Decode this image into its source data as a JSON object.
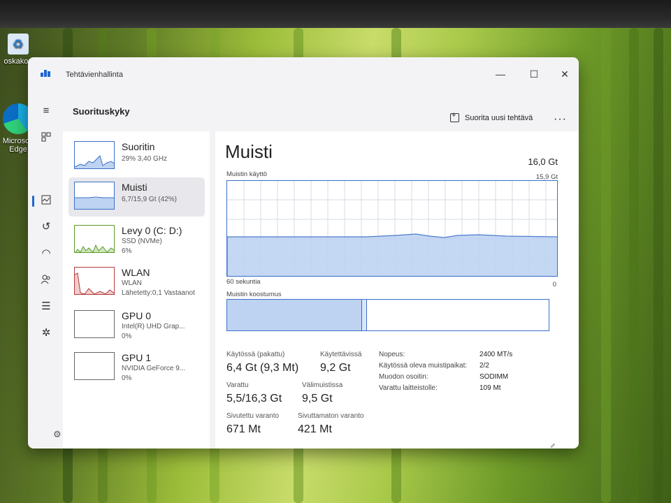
{
  "desktop": {
    "recycle_label": "oskakori",
    "edge_label_1": "Microsoft",
    "edge_label_2": "Edge"
  },
  "window": {
    "title": "Tehtävienhallinta",
    "header": "Suorituskyky",
    "run_new_task": "Suorita uusi tehtävä",
    "more": "···"
  },
  "perf_list": [
    {
      "name": "Suoritin",
      "sub1": "29% 3,40 GHz",
      "sub2": ""
    },
    {
      "name": "Muisti",
      "sub1": "6,7/15,9 Gt (42%)",
      "sub2": ""
    },
    {
      "name": "Levy 0 (C: D:)",
      "sub1": "SSD (NVMe)",
      "sub2": "6%"
    },
    {
      "name": "WLAN",
      "sub1": "WLAN",
      "sub2": "Lähetetty:0,1 Vastaanot"
    },
    {
      "name": "GPU 0",
      "sub1": "Intel(R) UHD Grap...",
      "sub2": "0%"
    },
    {
      "name": "GPU 1",
      "sub1": "NVIDIA GeForce 9...",
      "sub2": "0%"
    }
  ],
  "memory": {
    "title": "Muisti",
    "total": "16,0 Gt",
    "usage_label": "Muistin käyttö",
    "graph_max": "15,9 Gt",
    "time_label": "60 sekuntia",
    "zero": "0",
    "composition_label": "Muistin koostumus",
    "in_use_label": "Käytössä (pakattu)",
    "in_use_value": "6,4 Gt (9,3 Mt)",
    "available_label": "Käytettävissä",
    "available_value": "9,2 Gt",
    "committed_label": "Varattu",
    "committed_value": "5,5/16,3 Gt",
    "cached_label": "Välimuistissa",
    "cached_value": "9,5 Gt",
    "paged_label": "Sivutettu varanto",
    "paged_value": "671 Mt",
    "nonpaged_label": "Sivuttamaton varanto",
    "nonpaged_value": "421 Mt",
    "speed_key": "Nopeus:",
    "speed_val": "2400 MT/s",
    "slots_key": "Käytössä oleva muistipaikat:",
    "slots_val": "2/2",
    "form_key": "Muodon osoitin:",
    "form_val": "SODIMM",
    "reserved_key": "Varattu laitteistolle:",
    "reserved_val": "109 Mt",
    "usage_fraction": 0.42
  },
  "colors": {
    "accent": "#1f66d1",
    "graph_line": "#3a6fc9",
    "graph_fill": "#bed3f2"
  }
}
